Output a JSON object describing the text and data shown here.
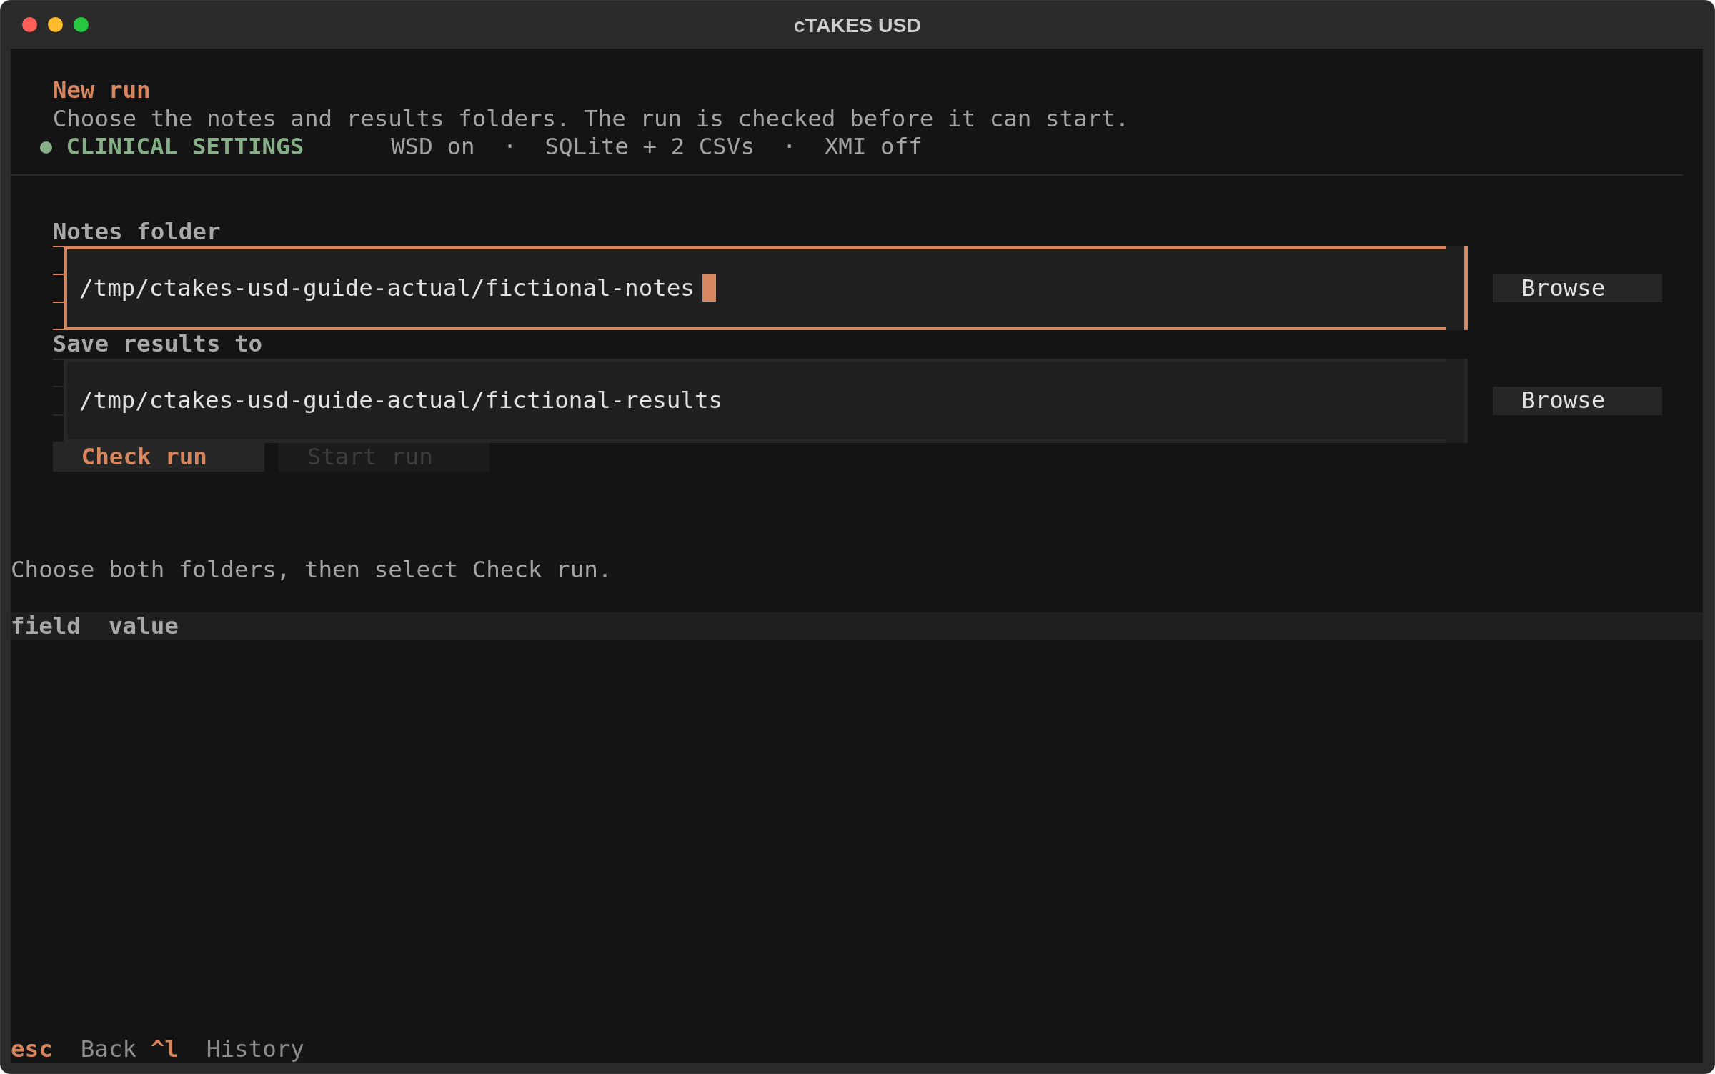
{
  "window": {
    "title": "cTAKES USD"
  },
  "header": {
    "title": "New run",
    "subtitle": "Choose the notes and results folders. The run is checked before it can start.",
    "profile": "CLINICAL SETTINGS",
    "summary": "WSD on  ·  SQLite + 2 CSVs  ·  XMI off"
  },
  "fields": [
    {
      "label": "Notes folder",
      "value": "/tmp/ctakes-usd-guide-actual/fictional-notes",
      "focused": true,
      "button": "Browse"
    },
    {
      "label": "Save results to",
      "value": "/tmp/ctakes-usd-guide-actual/fictional-results",
      "focused": false,
      "button": "Browse"
    }
  ],
  "actions": [
    {
      "label": "Check run",
      "disabled": false
    },
    {
      "label": "Start run",
      "disabled": true
    }
  ],
  "message": "Choose both folders, then select Check run.",
  "table": {
    "columns": [
      "field",
      "value"
    ]
  },
  "footer": {
    "bindings": [
      {
        "key": "esc",
        "label": "Back"
      },
      {
        "key": "^l",
        "label": "History"
      }
    ]
  }
}
